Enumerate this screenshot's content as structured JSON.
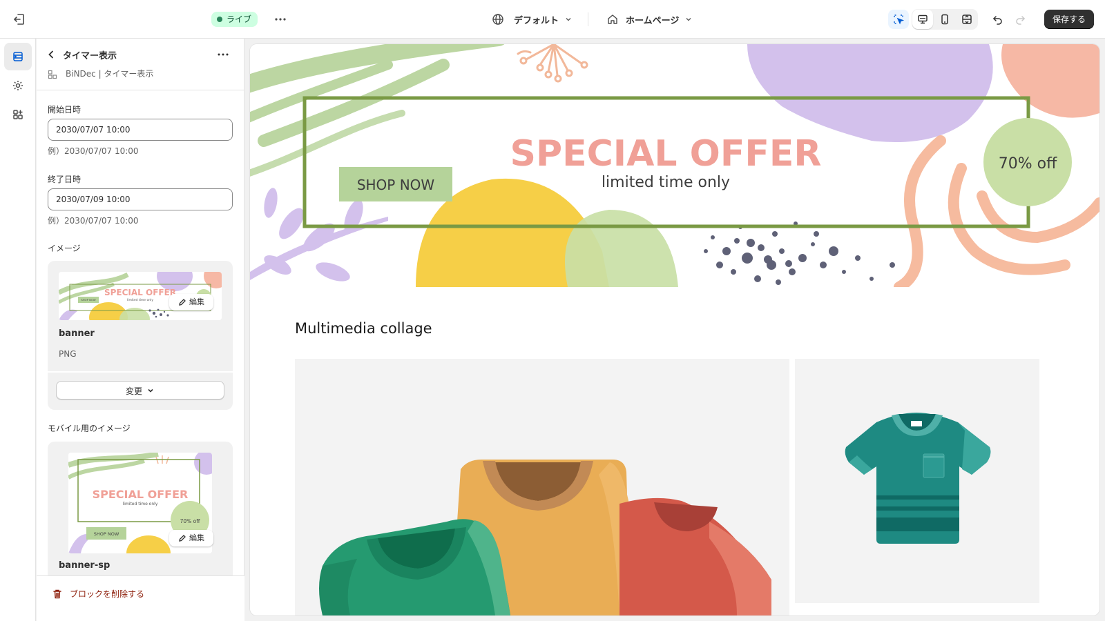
{
  "topbar": {
    "status": "ライブ",
    "theme_select": "デフォルト",
    "page_select": "ホームページ",
    "save_label": "保存する"
  },
  "panel": {
    "title": "タイマー表示",
    "breadcrumb": "BiNDec | タイマー表示",
    "start": {
      "label": "開始日時",
      "value": "2030/07/07 10:00",
      "help": "例）2030/07/07 10:00"
    },
    "end": {
      "label": "終了日時",
      "value": "2030/07/09 10:00",
      "help": "例）2030/07/07 10:00"
    },
    "image": {
      "label": "イメージ",
      "file_name": "banner",
      "file_type": "PNG",
      "edit_label": "編集",
      "change_label": "変更"
    },
    "mobile_image": {
      "label": "モバイル用のイメージ",
      "file_name": "banner-sp",
      "edit_label": "編集"
    },
    "delete_label": "ブロックを削除する"
  },
  "preview": {
    "banner": {
      "headline": "SPECIAL OFFER",
      "subline": "limited time only",
      "cta": "SHOP NOW",
      "badge": "70% off"
    },
    "collage_title": "Multimedia collage"
  },
  "colors": {
    "live_badge_bg": "#cdfee1",
    "save_button": "#303030",
    "banner_frame": "#7a9a44",
    "headline": "#f0a097",
    "cta_bg": "#b5d39a",
    "delete_text": "#8e1f0b"
  }
}
